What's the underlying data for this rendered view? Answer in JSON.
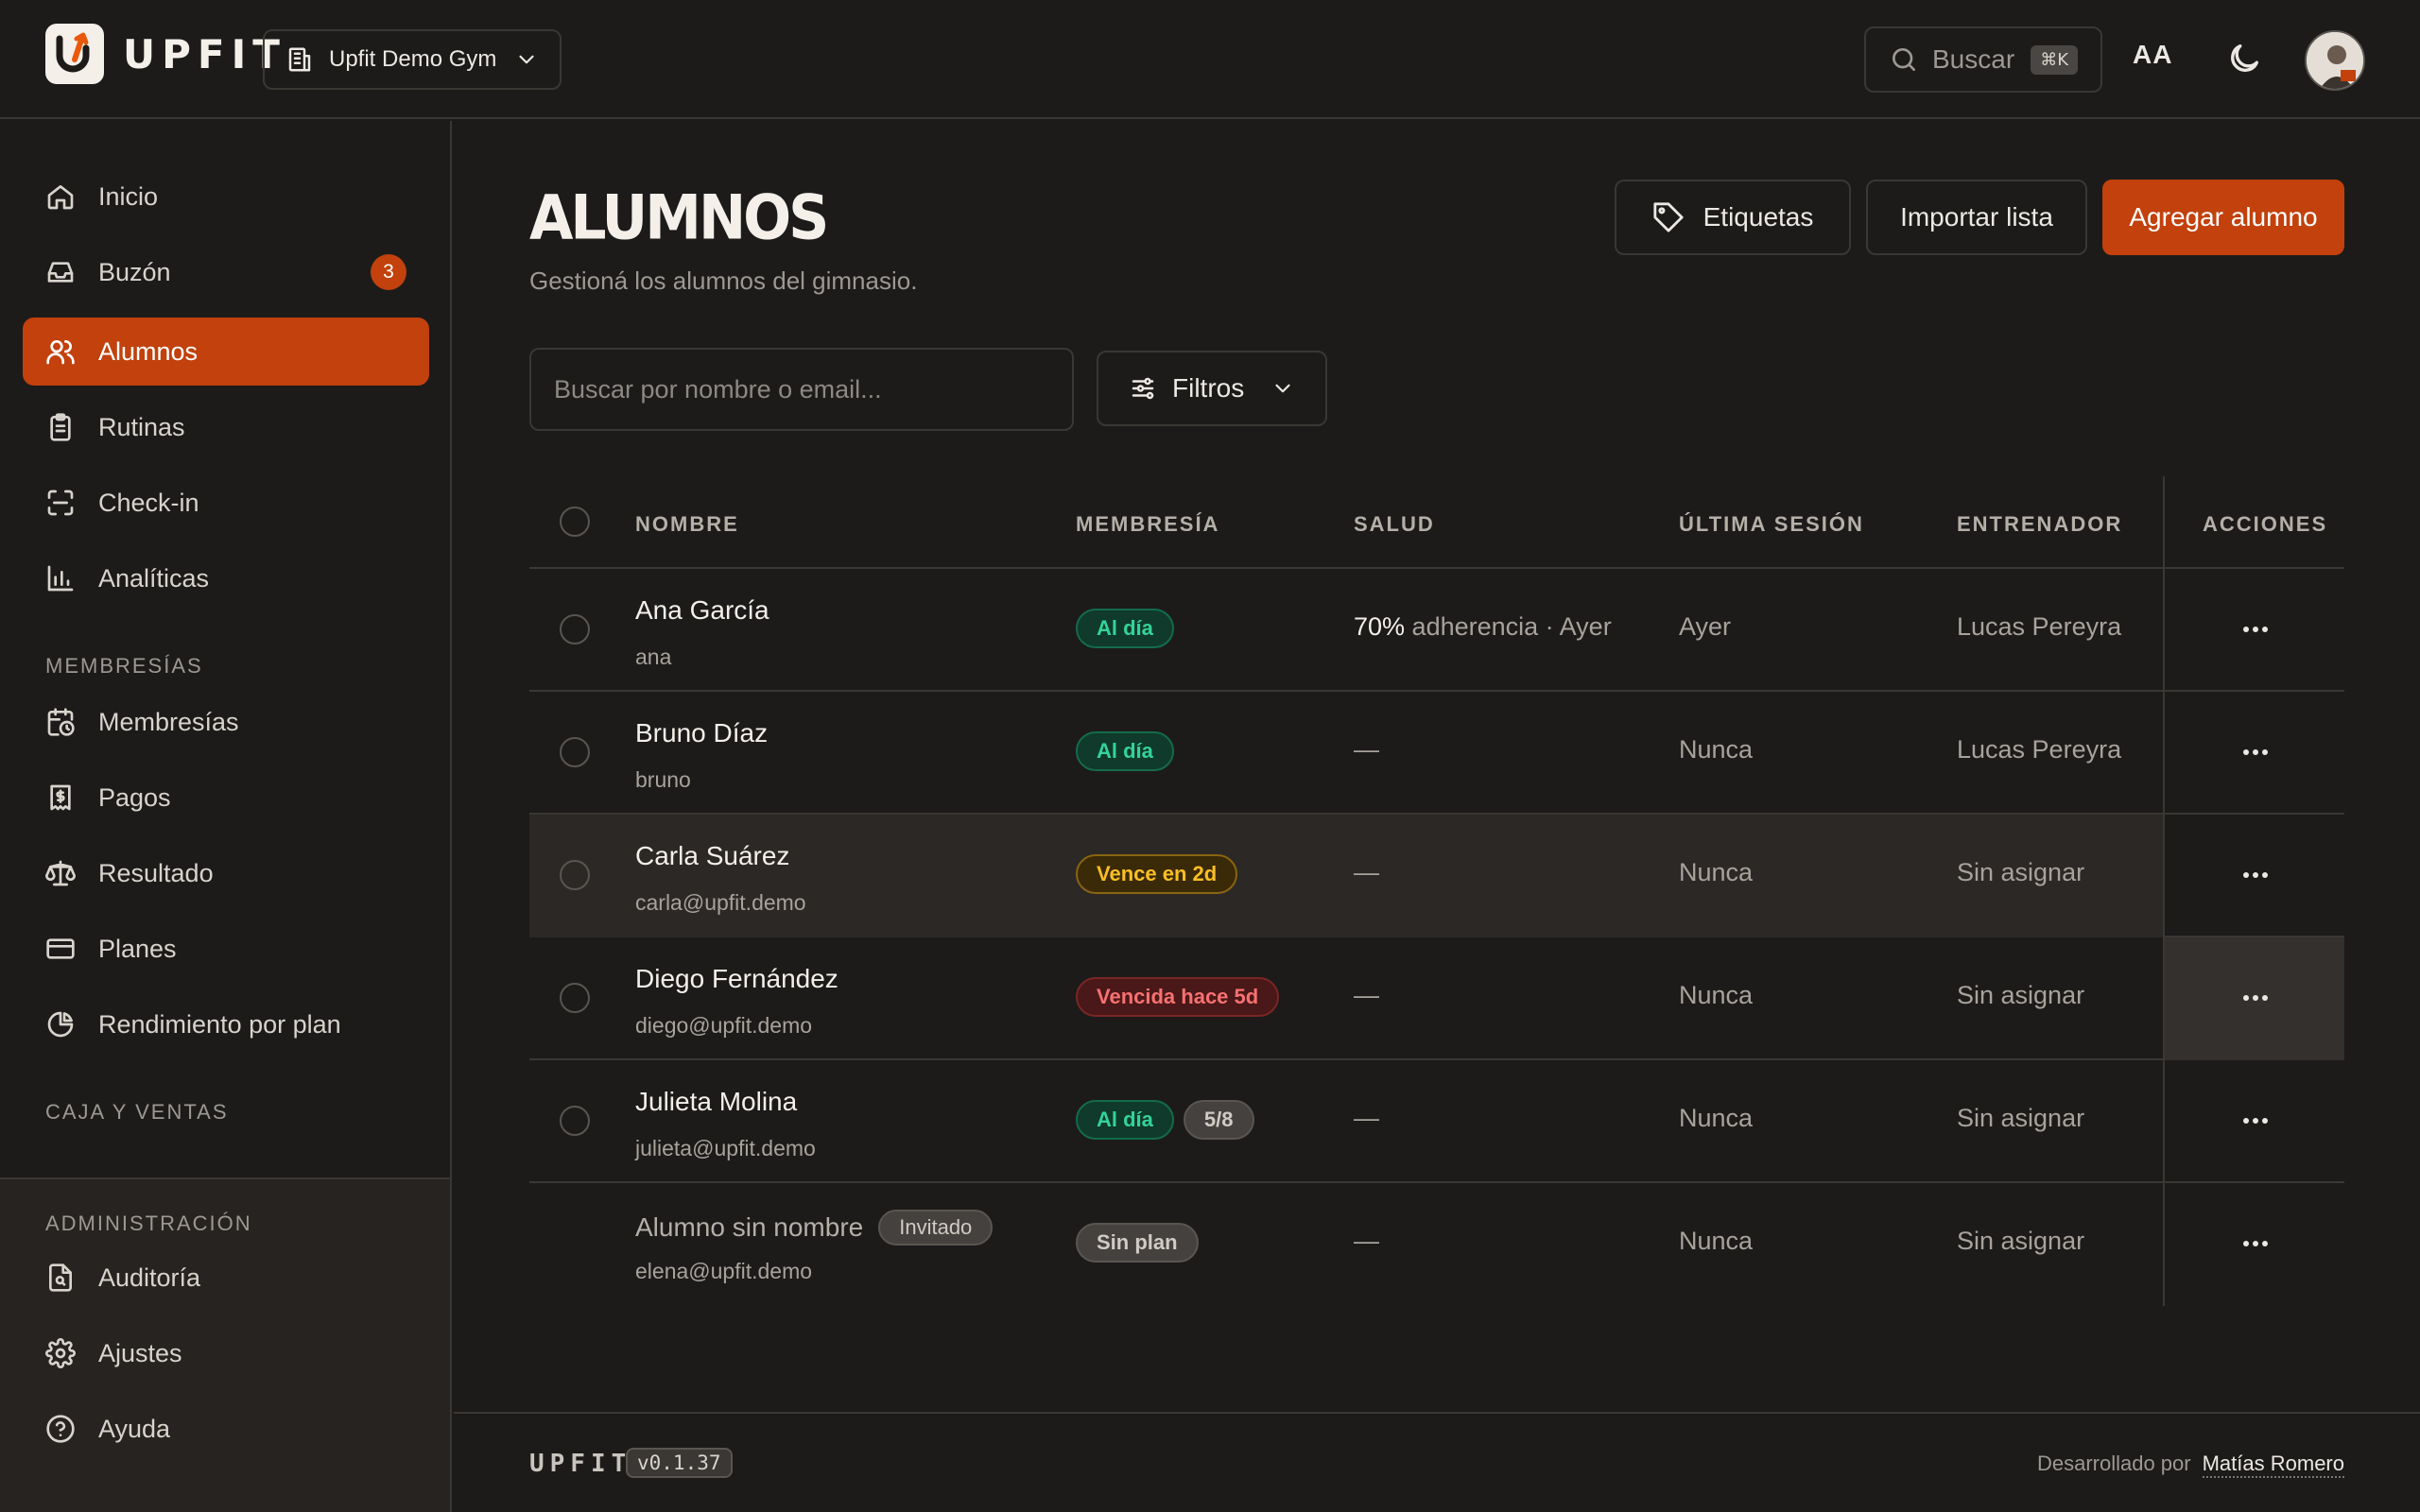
{
  "header": {
    "brand": "UPFIT",
    "gym": "Upfit Demo Gym",
    "search_label": "Buscar",
    "search_shortcut": "⌘K",
    "font_toggle": "AA"
  },
  "sidebar": {
    "items": [
      {
        "label": "Inicio",
        "icon": "home-icon"
      },
      {
        "label": "Buzón",
        "icon": "inbox-icon",
        "badge": "3"
      },
      {
        "label": "Alumnos",
        "icon": "users-icon",
        "active": true
      },
      {
        "label": "Rutinas",
        "icon": "clipboard-icon"
      },
      {
        "label": "Check-in",
        "icon": "scan-icon"
      },
      {
        "label": "Analíticas",
        "icon": "bar-chart-icon"
      }
    ],
    "section_memberships": "MEMBRESÍAS",
    "membership_items": [
      {
        "label": "Membresías",
        "icon": "calendar-clock-icon"
      },
      {
        "label": "Pagos",
        "icon": "receipt-icon"
      },
      {
        "label": "Resultado",
        "icon": "scale-icon"
      },
      {
        "label": "Planes",
        "icon": "credit-card-icon"
      },
      {
        "label": "Rendimiento por plan",
        "icon": "pie-chart-icon"
      }
    ],
    "section_sales": "CAJA Y VENTAS",
    "section_admin": "ADMINISTRACIÓN",
    "admin_items": [
      {
        "label": "Auditoría",
        "icon": "file-search-icon"
      },
      {
        "label": "Ajustes",
        "icon": "gear-icon"
      },
      {
        "label": "Ayuda",
        "icon": "help-icon"
      }
    ]
  },
  "main": {
    "title": "ALUMNOS",
    "subtitle": "Gestioná los alumnos del gimnasio.",
    "buttons": {
      "tags": "Etiquetas",
      "import": "Importar lista",
      "add": "Agregar alumno"
    },
    "search_placeholder": "Buscar por nombre o email...",
    "filters_label": "Filtros"
  },
  "table": {
    "columns": [
      "NOMBRE",
      "MEMBRESÍA",
      "SALUD",
      "ÚLTIMA SESIÓN",
      "ENTRENADOR",
      "ACCIONES"
    ],
    "rows": [
      {
        "name": "Ana García",
        "sub": "ana",
        "membership": "Al día",
        "membership_status": "green",
        "health_pct": "70%",
        "health_rest": " adherencia · Ayer",
        "last_session": "Ayer",
        "trainer": "Lucas Pereyra"
      },
      {
        "name": "Bruno Díaz",
        "sub": "bruno",
        "membership": "Al día",
        "membership_status": "green",
        "health": "—",
        "last_session": "Nunca",
        "trainer": "Lucas Pereyra"
      },
      {
        "name": "Carla Suárez",
        "sub": "carla@upfit.demo",
        "membership": "Vence en 2d",
        "membership_status": "amber",
        "health": "—",
        "last_session": "Nunca",
        "trainer": "Sin asignar"
      },
      {
        "name": "Diego Fernández",
        "sub": "diego@upfit.demo",
        "membership": "Vencida hace 5d",
        "membership_status": "red",
        "health": "—",
        "last_session": "Nunca",
        "trainer": "Sin asignar"
      },
      {
        "name": "Julieta Molina",
        "sub": "julieta@upfit.demo",
        "membership": "Al día",
        "membership_status": "green",
        "membership_extra": "5/8",
        "health": "—",
        "last_session": "Nunca",
        "trainer": "Sin asignar"
      },
      {
        "name": "Alumno sin nombre",
        "name_badge": "Invitado",
        "sub": "elena@upfit.demo",
        "membership": "Sin plan",
        "membership_status": "gray",
        "health": "—",
        "last_session": "Nunca",
        "trainer": "Sin asignar"
      }
    ]
  },
  "footer": {
    "brand": "UPFIT",
    "version": "v0.1.37",
    "dev_prefix": "Desarrollado por",
    "author": "Matías Romero"
  },
  "colors": {
    "accent": "#c2410c",
    "background": "#1c1b1a",
    "status_green": "#34d399",
    "status_amber": "#fbbf24",
    "status_red": "#f87171"
  }
}
